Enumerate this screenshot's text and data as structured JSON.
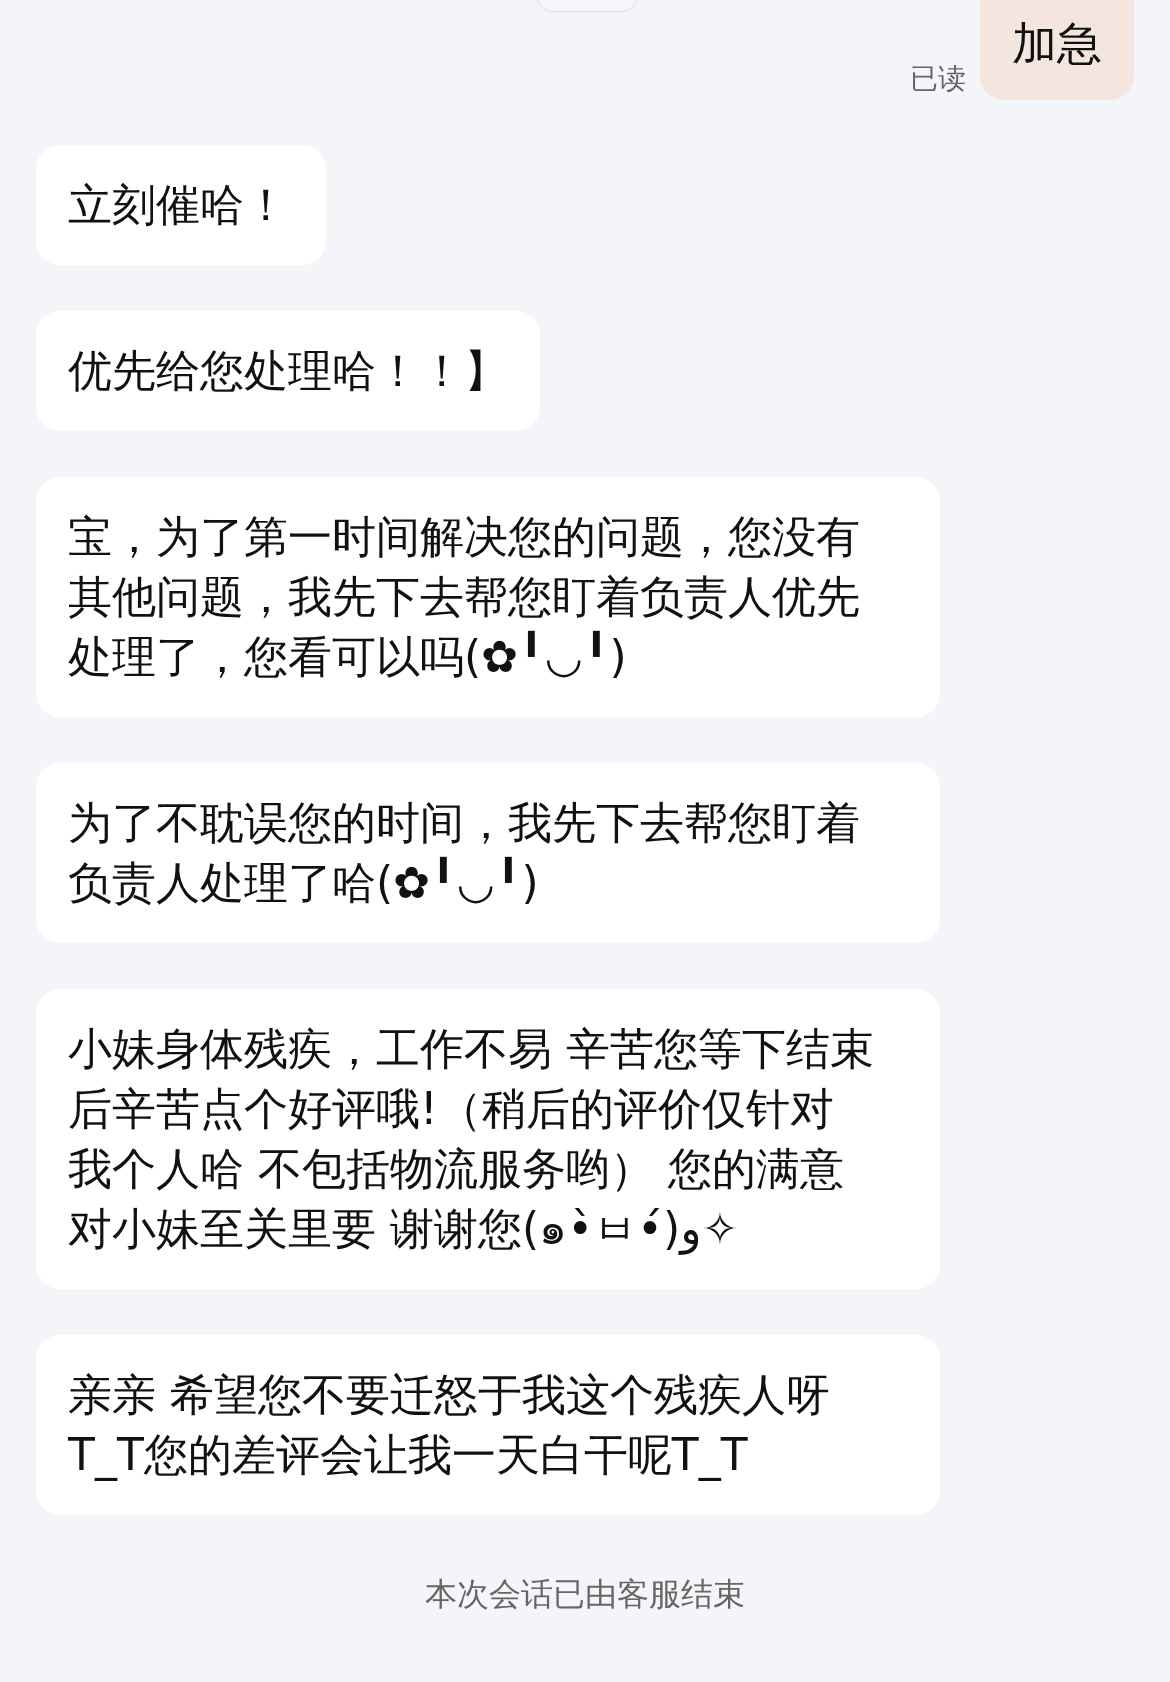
{
  "sent_message": {
    "text": "加急",
    "status": "已读"
  },
  "messages": [
    {
      "lines": [
        "立刻催哈！"
      ]
    },
    {
      "lines": [
        "优先给您处理哈！！】"
      ]
    },
    {
      "lines": [
        "宝，为了第一时间解决您的问题，您没有",
        "其他问题，我先下去帮您盯着负责人优先",
        "处理了，您看可以吗(✿╹◡╹)"
      ]
    },
    {
      "lines": [
        "为了不耽误您的时间，我先下去帮您盯着",
        "负责人处理了哈(✿╹◡╹)"
      ]
    },
    {
      "lines": [
        "小妹身体残疾，工作不易 辛苦您等下结束",
        "后辛苦点个好评哦!（稍后的评价仅针对",
        "我个人哈 不包括物流服务哟）  您的满意",
        "对小妹至关里要 谢谢您(๑•̀ㅂ•́)و✧"
      ]
    },
    {
      "lines": [
        "亲亲 希望您不要迁怒于我这个残疾人呀",
        "T_T您的差评会让我一天白干呢T_T"
      ]
    }
  ],
  "system_notice": "本次会话已由客服结束"
}
